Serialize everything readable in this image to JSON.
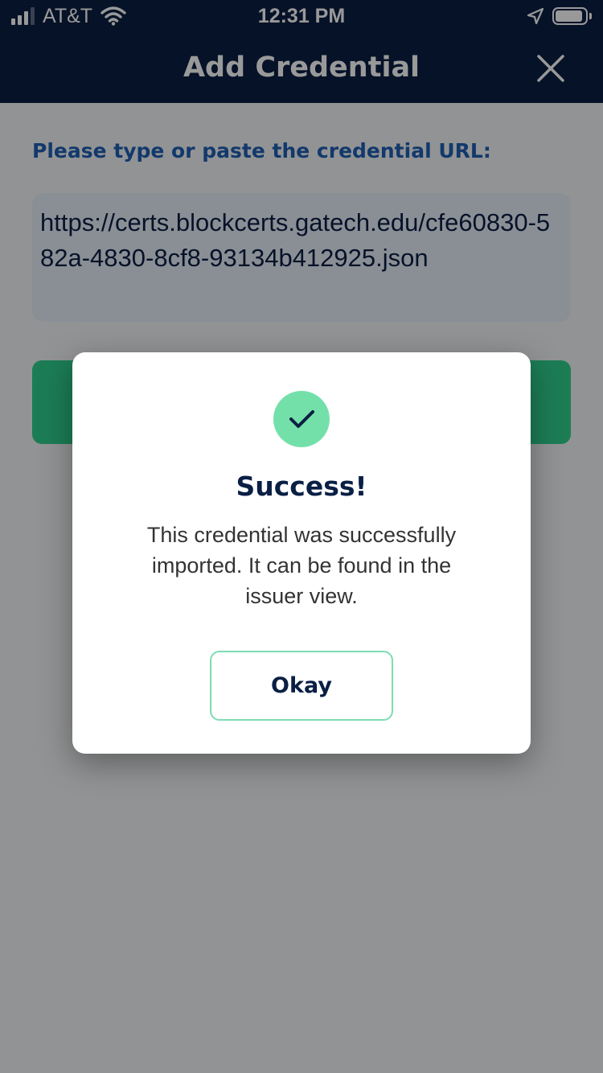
{
  "status_bar": {
    "carrier": "AT&T",
    "time": "12:31 PM",
    "icons": [
      "signal-icon",
      "wifi-icon",
      "location-arrow-icon",
      "battery-icon"
    ]
  },
  "nav": {
    "title": "Add Credential",
    "close_icon": "close-icon"
  },
  "form": {
    "url_label": "Please type or paste the credential URL:",
    "url_value": "https://certs.blockcerts.gatech.edu/cfe60830-582a-4830-8cf8-93134b412925.json"
  },
  "dialog": {
    "icon": "check-circle-icon",
    "title": "Success!",
    "message": "This credential was successfully imported. It can be found in the issuer view.",
    "button_label": "Okay"
  },
  "colors": {
    "nav_background": "#0a1f44",
    "label_blue": "#1f5fb5",
    "primary_green": "#2fd08e",
    "success_green": "#74e0a9",
    "button_border": "#7ddcb3"
  }
}
